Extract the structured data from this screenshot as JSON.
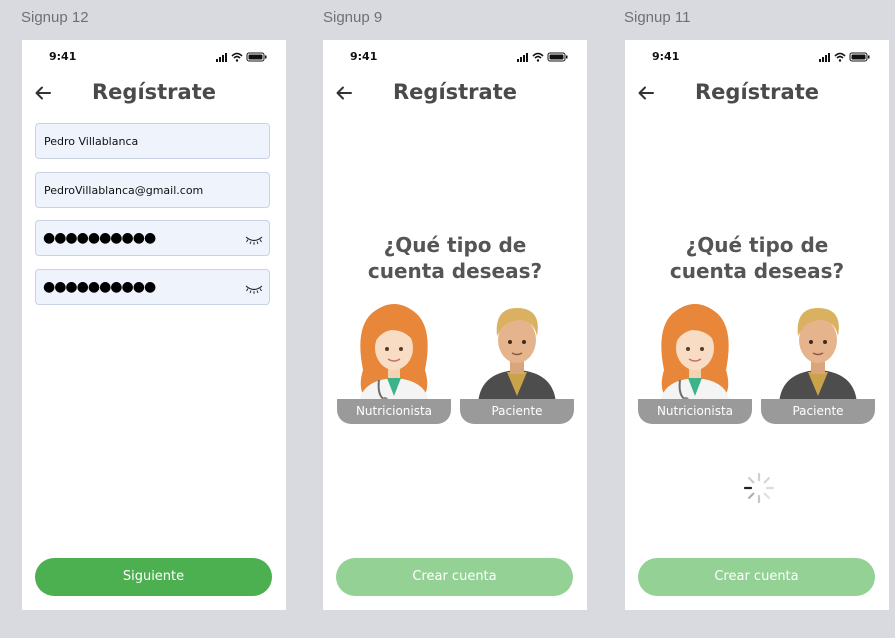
{
  "colors": {
    "primary": "#4caf50",
    "primary_disabled": "#93d294",
    "input_bg": "#eef3fc",
    "label_bg": "#9a9a9a"
  },
  "frames": [
    {
      "label": "Signup 12",
      "time": "9:41",
      "title": "Regístrate",
      "fields": {
        "name": "Pedro Villablanca",
        "email": "PedroVillablanca@gmail.com",
        "password": "●●●●●●●●●●",
        "password_confirm": "●●●●●●●●●●"
      },
      "button": "Siguiente"
    },
    {
      "label": "Signup 9",
      "time": "9:41",
      "title": "Regístrate",
      "question": "¿Qué tipo de cuenta deseas?",
      "options": [
        "Nutricionista",
        "Paciente"
      ],
      "button": "Crear cuenta"
    },
    {
      "label": "Signup 11",
      "time": "9:41",
      "title": "Regístrate",
      "question": "¿Qué tipo de cuenta deseas?",
      "options": [
        "Nutricionista",
        "Paciente"
      ],
      "button": "Crear cuenta",
      "loading": true
    }
  ]
}
